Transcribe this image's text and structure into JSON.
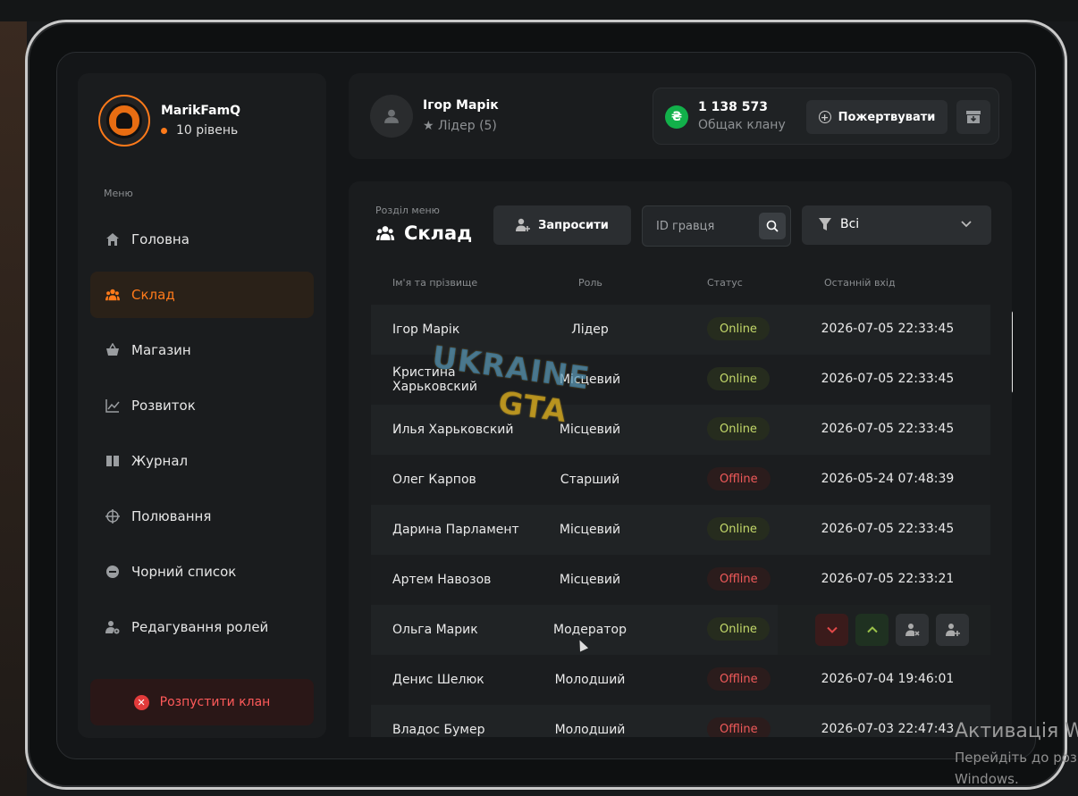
{
  "sidebar": {
    "clan_name": "MarikFamQ",
    "level": "10 рівень",
    "menu_heading": "Меню",
    "items": [
      {
        "label": "Головна",
        "icon": "home-icon"
      },
      {
        "label": "Склад",
        "icon": "users-icon",
        "active": true
      },
      {
        "label": "Магазин",
        "icon": "basket-icon"
      },
      {
        "label": "Розвиток",
        "icon": "chart-icon"
      },
      {
        "label": "Журнал",
        "icon": "book-icon"
      },
      {
        "label": "Полювання",
        "icon": "crosshair-icon"
      },
      {
        "label": "Чорний список",
        "icon": "minus-circle-icon"
      },
      {
        "label": "Редагування ролей",
        "icon": "user-gear-icon"
      }
    ],
    "disband_label": "Розпустити клан"
  },
  "header": {
    "user_name": "Ігор Марік",
    "user_role": "Лідер (5)",
    "bank_amount": "1 138 573",
    "bank_label": "Общак клану",
    "currency_symbol": "₴",
    "donate_label": "Пожертвувати"
  },
  "main": {
    "section_label": "Розділ меню",
    "section_title": "Склад",
    "invite_label": "Запросити",
    "search_placeholder": "ID гравця",
    "filter_value": "Всі",
    "columns": [
      "Ім'я та прізвище",
      "Роль",
      "Статус",
      "Останній вхід"
    ],
    "rows": [
      {
        "name": "Ігор Марік",
        "role": "Лідер",
        "status": "Online",
        "last": "2026-07-05 22:33:45"
      },
      {
        "name": "Кристина Харьковский",
        "role": "Місцевий",
        "status": "Online",
        "last": "2026-07-05 22:33:45"
      },
      {
        "name": "Илья Харьковский",
        "role": "Місцевий",
        "status": "Online",
        "last": "2026-07-05 22:33:45"
      },
      {
        "name": "Олег Карпов",
        "role": "Старший",
        "status": "Offline",
        "last": "2026-05-24 07:48:39"
      },
      {
        "name": "Дарина Парламент",
        "role": "Місцевий",
        "status": "Online",
        "last": "2026-07-05 22:33:45"
      },
      {
        "name": "Артем Навозов",
        "role": "Місцевий",
        "status": "Offline",
        "last": "2026-07-05 22:33:21"
      },
      {
        "name": "Ольга Марик",
        "role": "Модератор",
        "status": "Online",
        "last": ""
      },
      {
        "name": "Денис Шелюк",
        "role": "Молодший",
        "status": "Offline",
        "last": "2026-07-04 19:46:01"
      },
      {
        "name": "Владос Бумер",
        "role": "Молодший",
        "status": "Offline",
        "last": "2026-07-03 22:47:43"
      }
    ]
  },
  "watermark": {
    "line1": "UKRAINE",
    "line2": "GTA"
  },
  "os_overlay": {
    "line1": "Активація W",
    "line2": "Перейдіть до роз",
    "line3": "Windows."
  },
  "colors": {
    "accent": "#ff7a1a",
    "online": "#c4d96a",
    "offline": "#f05a5a",
    "bank_green": "#12b04a"
  }
}
